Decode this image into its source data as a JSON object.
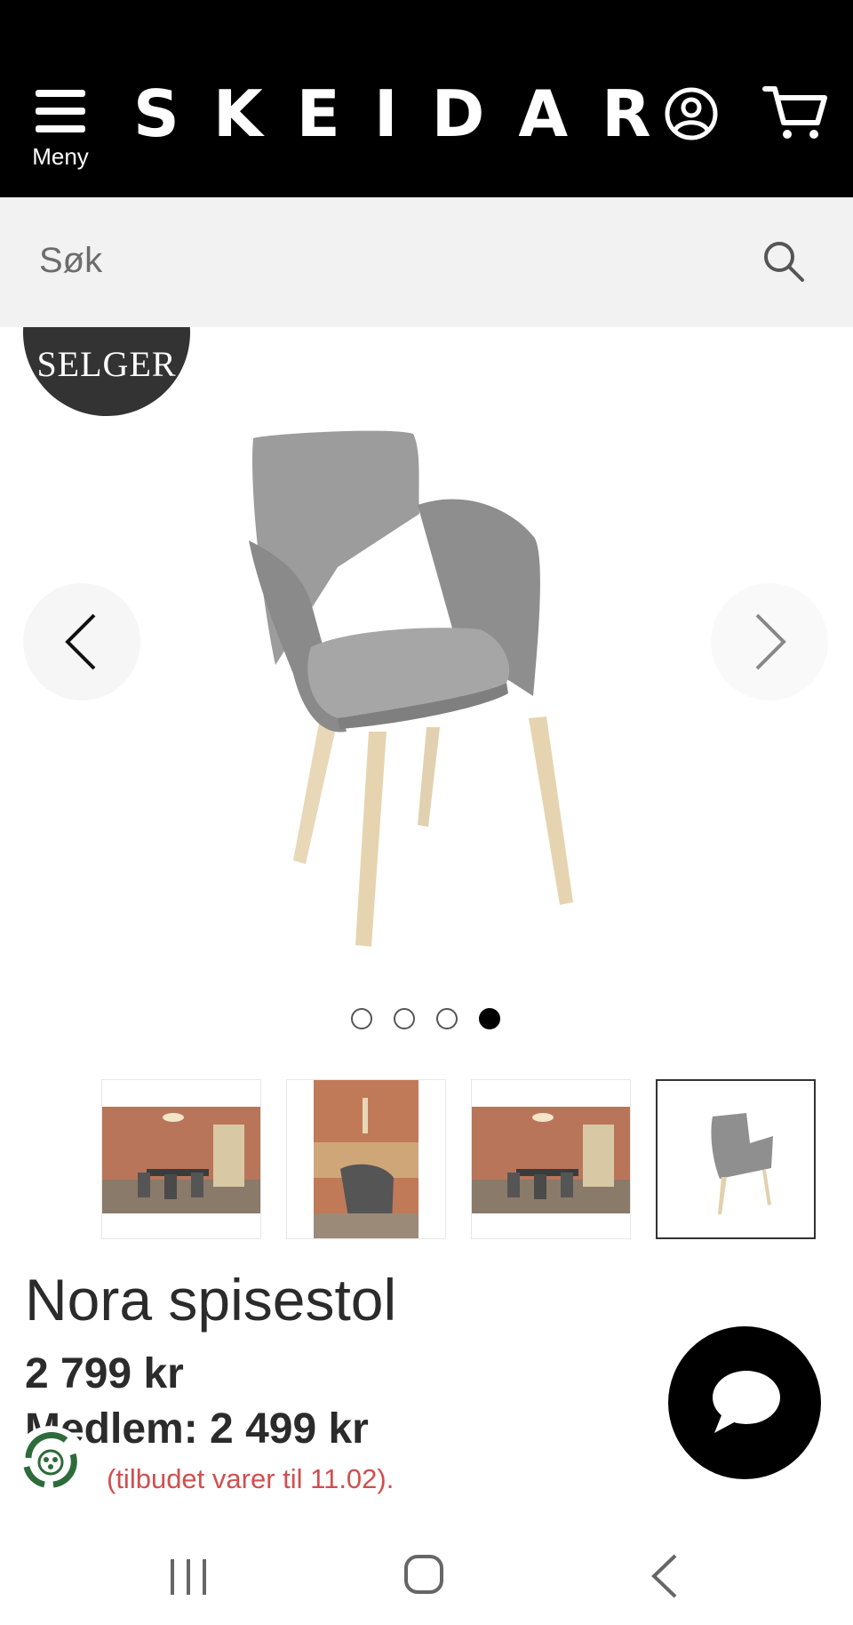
{
  "header": {
    "menu_label": "Meny",
    "logo_text": "SKEIDAR",
    "background": "#000000"
  },
  "search": {
    "placeholder": "Søk"
  },
  "gallery": {
    "badge_label": "SELGER",
    "slide_count": 4,
    "active_slide": 4,
    "thumbnails": [
      {
        "name": "thumbnail-dining-room-wide"
      },
      {
        "name": "thumbnail-dining-table-closeup"
      },
      {
        "name": "thumbnail-dining-room-wide-2"
      },
      {
        "name": "thumbnail-chair-product",
        "active": true
      }
    ]
  },
  "product": {
    "title": "Nora spisestol",
    "price": "2 799 kr",
    "member_price": "Medlem: 2 499 kr",
    "offer_note": "(tilbudet varer til 11.02)."
  },
  "colors": {
    "accent_red": "#d24e4e",
    "text_dark": "#2b2b2b",
    "eco_green": "#2e6b3a"
  },
  "icons": {
    "menu": "hamburger-icon",
    "user": "user-circle-icon",
    "cart": "cart-icon",
    "search": "search-icon",
    "prev": "chevron-left-icon",
    "next": "chevron-right-icon",
    "chat": "chat-bubble-icon",
    "eco": "recycle-icon"
  }
}
